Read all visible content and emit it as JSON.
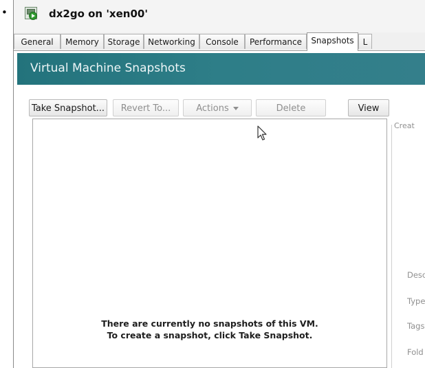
{
  "window": {
    "title": "dx2go on 'xen00'",
    "icon": "vm-running-icon"
  },
  "tabs": [
    {
      "label": "General",
      "active": false
    },
    {
      "label": "Memory",
      "active": false
    },
    {
      "label": "Storage",
      "active": false
    },
    {
      "label": "Networking",
      "active": false
    },
    {
      "label": "Console",
      "active": false
    },
    {
      "label": "Performance",
      "active": false
    },
    {
      "label": "Snapshots",
      "active": true
    },
    {
      "label": "L",
      "active": false
    }
  ],
  "banner": {
    "title": "Virtual Machine Snapshots",
    "color": "#2a7882"
  },
  "toolbar": {
    "take_snapshot": "Take Snapshot...",
    "revert_to": "Revert To...",
    "actions": "Actions",
    "delete": "Delete",
    "view": "View"
  },
  "snapshot_list": {
    "empty_line1": "There are currently no snapshots of this VM.",
    "empty_line2": "To create a snapshot, click Take Snapshot."
  },
  "properties": {
    "group_label": "Creat",
    "labels": [
      "Desc",
      "Type",
      "Tags",
      "Fold"
    ]
  }
}
